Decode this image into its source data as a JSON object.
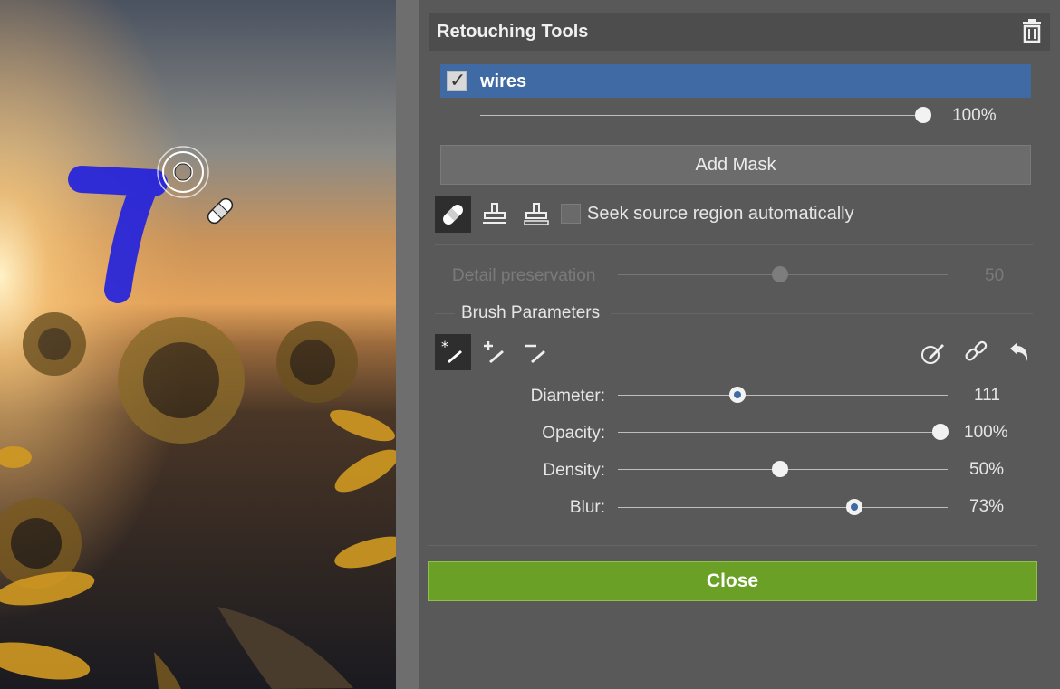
{
  "panel": {
    "title": "Retouching Tools",
    "mask": {
      "name": "wires",
      "checked": true,
      "opacity": "100%"
    },
    "add_mask_label": "Add Mask",
    "tools": [
      "healing-brush-icon",
      "clone-stamp-icon",
      "source-stamp-icon"
    ],
    "seek_source_label": "Seek source region automatically",
    "detail": {
      "label": "Detail preservation",
      "value": "50"
    },
    "brush_section_title": "Brush Parameters",
    "brush_modes": [
      "brush-draw-icon",
      "brush-add-icon",
      "brush-erase-icon"
    ],
    "brush_actions": [
      "pick-brush-icon",
      "link-icon",
      "undo-icon"
    ],
    "params": [
      {
        "label": "Diameter:",
        "value": "111"
      },
      {
        "label": "Opacity:",
        "value": "100%"
      },
      {
        "label": "Density:",
        "value": "50%"
      },
      {
        "label": "Blur:",
        "value": "73%"
      }
    ],
    "close_label": "Close"
  },
  "colors": {
    "selection": "#3f6aa3",
    "close_button": "#6aa026",
    "mask_paint": "#1f1fe0"
  }
}
